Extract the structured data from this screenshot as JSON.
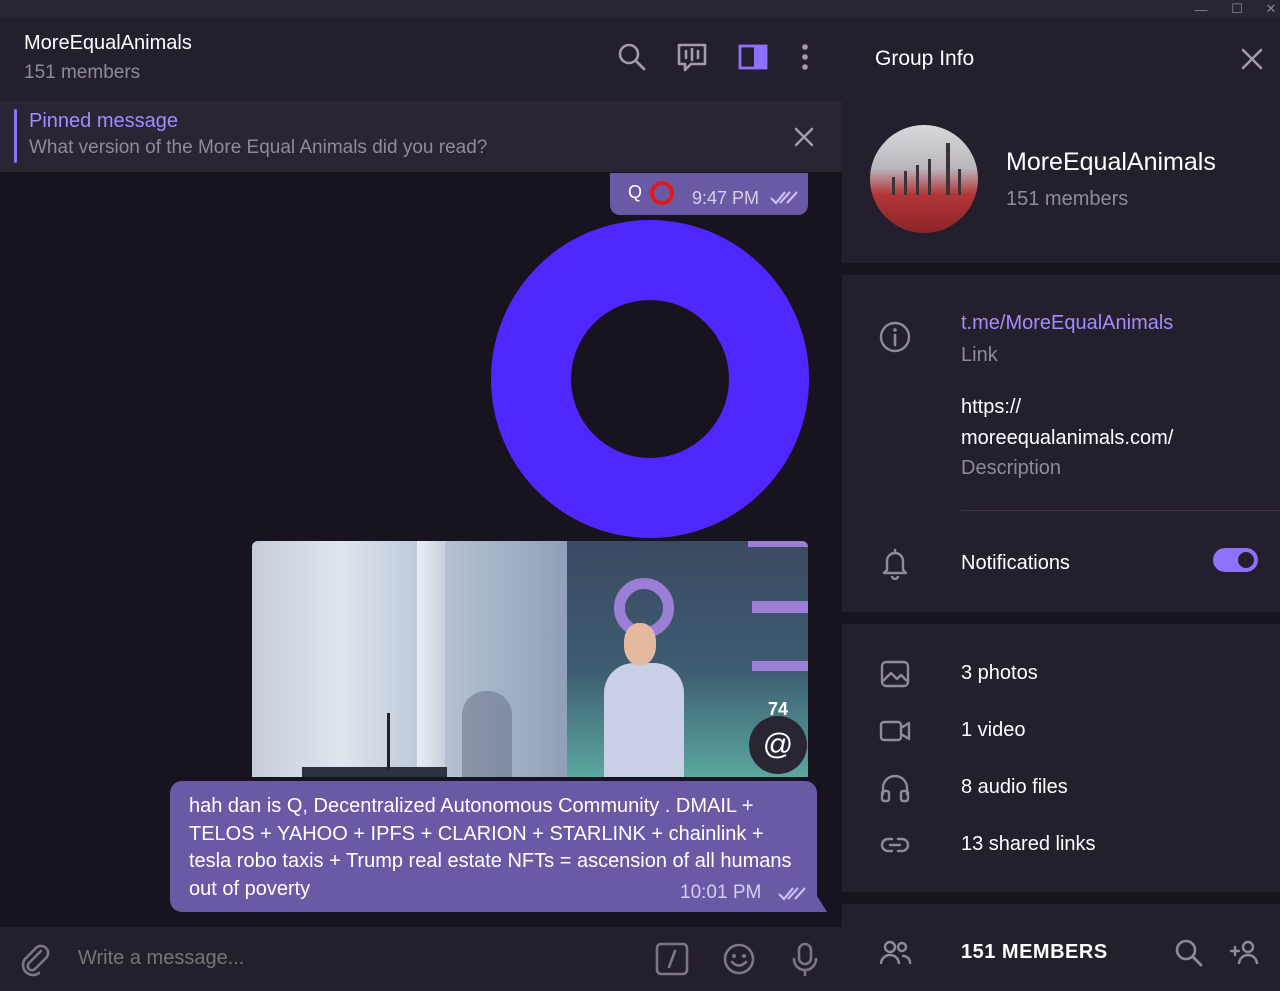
{
  "window": {
    "minimize": "—",
    "maximize": "☐",
    "close": "✕"
  },
  "chat": {
    "title": "MoreEqualAnimals",
    "subtitle": "151 members"
  },
  "pinned": {
    "label": "Pinned message",
    "text": "What version of the More Equal Animals did you read?"
  },
  "messages": {
    "first": {
      "prefix": "Q",
      "time": "9:47 PM"
    },
    "mention_count": "74",
    "mention_symbol": "@",
    "last": {
      "text": "hah dan is Q, Decentralized Autonomous Community . DMAIL + TELOS + YAHOO + IPFS + CLARION + STARLINK + chainlink + tesla robo taxis + Trump real estate NFTs = ascension of all humans out of poverty",
      "time": "10:01 PM"
    }
  },
  "composer": {
    "placeholder": "Write a message..."
  },
  "info": {
    "title": "Group Info",
    "name": "MoreEqualAnimals",
    "members": "151 members",
    "link": "t.me/MoreEqualAnimals",
    "link_label": "Link",
    "description_line1": "https://",
    "description_line2": "moreequalanimals.com/",
    "description_label": "Description",
    "notifications_label": "Notifications",
    "notifications_on": true,
    "media": {
      "photos": "3 photos",
      "video": "1 video",
      "audio": "8 audio files",
      "links": "13 shared links"
    },
    "members_header": "151 MEMBERS"
  },
  "colors": {
    "accent": "#8d71ff",
    "bubble": "#6a5aa6",
    "ring": "#5127ff",
    "panel": "#241f2d",
    "background": "#17141f"
  }
}
